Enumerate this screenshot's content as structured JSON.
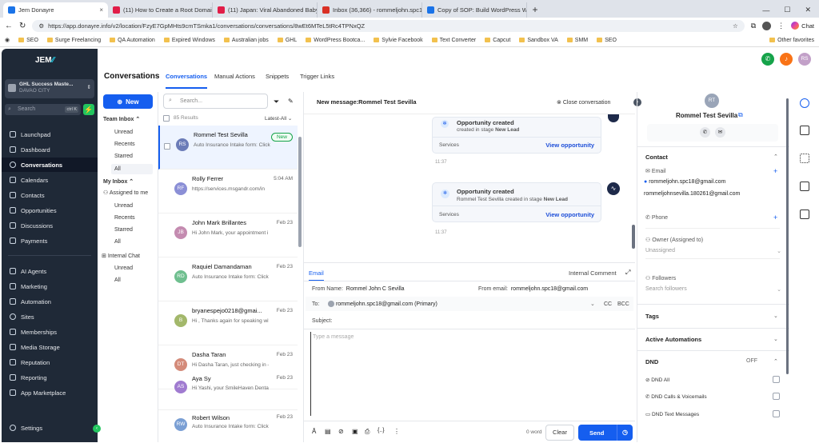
{
  "browser": {
    "tabs": [
      {
        "label": "Jem Donayre",
        "active": true,
        "color": "#1a73e8"
      },
      {
        "label": "(11) How to Create a Root Domain",
        "color": "#e11d48"
      },
      {
        "label": "(11) Japan: Viral Abandoned Baby",
        "color": "#e11d48"
      },
      {
        "label": "Inbox (36,366) - rommeljohn.spc18",
        "color": "#d93025"
      },
      {
        "label": "Copy of SOP: Build WordPress We",
        "color": "#1a73e8"
      }
    ],
    "url": "https://app.donayre.info/v2/location/FzyE7GpMHts9cmTSmka1/conversations/conversations/8wEt6MTeL5tRc4TPNxQZ",
    "chat_label": "Chat",
    "bookmarks": [
      "SEO",
      "Surge Freelancing",
      "QA Automation",
      "Expired Windows",
      "Australian jobs",
      "GHL",
      "WordPress Bootca...",
      "Sylvie Facebook",
      "Text Converter",
      "Capcut",
      "Sandbox VA",
      "SMM",
      "SEO"
    ],
    "other_favorites": "Other favorites"
  },
  "sidebar": {
    "logo": "JEM",
    "location_name": "GHL Success Maste...",
    "location_city": "DAVAO CITY",
    "search_placeholder": "Search",
    "search_shortcut": "ctrl K",
    "items": [
      {
        "label": "Launchpad"
      },
      {
        "label": "Dashboard"
      },
      {
        "label": "Conversations",
        "active": true
      },
      {
        "label": "Calendars"
      },
      {
        "label": "Contacts"
      },
      {
        "label": "Opportunities"
      },
      {
        "label": "Discussions"
      },
      {
        "label": "Payments"
      }
    ],
    "items2": [
      {
        "label": "AI Agents"
      },
      {
        "label": "Marketing"
      },
      {
        "label": "Automation"
      },
      {
        "label": "Sites"
      },
      {
        "label": "Memberships"
      },
      {
        "label": "Media Storage"
      },
      {
        "label": "Reputation"
      },
      {
        "label": "Reporting"
      },
      {
        "label": "App Marketplace"
      }
    ],
    "settings": "Settings"
  },
  "header": {
    "title": "Conversations",
    "tabs": [
      {
        "label": "Conversations",
        "active": true
      },
      {
        "label": "Manual Actions"
      },
      {
        "label": "Snippets"
      },
      {
        "label": "Trigger Links"
      }
    ],
    "user_initials": "RS"
  },
  "filters": {
    "new_label": "New",
    "team_inbox": "Team Inbox",
    "team_items": [
      "Unread",
      "Recents",
      "Starred",
      "All"
    ],
    "my_inbox": "My Inbox",
    "assigned": "Assigned to me",
    "my_items": [
      "Unread",
      "Recents",
      "Starred",
      "All"
    ],
    "internal_chat": "Internal Chat",
    "internal_items": [
      "Unread",
      "All"
    ]
  },
  "list": {
    "search_placeholder": "Search...",
    "count": "85 Results",
    "sort": "Latest-All",
    "conversations": [
      {
        "initials": "RS",
        "name": "Rommel Test Sevilla",
        "preview": "Auto Insurance Intake form: Click",
        "date": "",
        "badge": "New",
        "color": "#6b7cb8"
      },
      {
        "initials": "RF",
        "name": "Rolly Ferrer",
        "preview": "https://services.msgandr.com/in",
        "date": "5:04 AM",
        "color": "#8b8fd6"
      },
      {
        "initials": "JB",
        "name": "John Mark Brillantes",
        "preview": "Hi John Mark, your appointment i",
        "date": "Feb 23",
        "color": "#c48bb0"
      },
      {
        "initials": "RD",
        "name": "Raquiel Damandaman",
        "preview": "Auto Insurance Intake form: Click",
        "date": "Feb 23",
        "color": "#6fbf8f"
      },
      {
        "initials": "B",
        "name": "bryanespejo0218@gmai...",
        "preview": "Hi , Thanks again for speaking wit",
        "date": "Feb 23",
        "color": "#a3b86b"
      },
      {
        "initials": "DT",
        "name": "Dasha Taran",
        "preview": "Hi Dasha Taran, just checking in –",
        "date": "Feb 23",
        "color": "#d48b7a"
      },
      {
        "initials": "AS",
        "name": "Aya Sy",
        "preview": "Hi Yashi, your SmileHaven Dental",
        "date": "Feb 23",
        "color": "#a07bd0"
      },
      {
        "initials": "RW",
        "name": "Robert Wilson",
        "preview": "Auto Insurance Intake form: Click",
        "date": "Feb 23",
        "color": "#7a9fd4"
      }
    ]
  },
  "chat": {
    "title": "New message:Rommel Test Sevilla",
    "close_label": "Close conversation",
    "cards": [
      {
        "title": "Opportunity created",
        "desc_prefix": "created in stage ",
        "stage": "New Lead",
        "service": "Services",
        "link": "View opportunity",
        "time": "11:37"
      },
      {
        "title": "Opportunity created",
        "desc_prefix": "Rommel Test Sevilla created in stage ",
        "stage": "New Lead",
        "service": "Services",
        "link": "View opportunity",
        "time": "11:37"
      }
    ]
  },
  "composer": {
    "tab_email": "Email",
    "tab_internal": "Internal Comment",
    "from_name_label": "From Name:",
    "from_name": "Rommel John C Sevilla",
    "from_email_label": "From email:",
    "from_email": "rommeljohn.spc18@gmail.com",
    "to_label": "To:",
    "to_value": "rommeljohn.spc18@gmail.com (Primary)",
    "cc": "CC",
    "bcc": "BCC",
    "subject_label": "Subject:",
    "placeholder": "Type a message",
    "word_count": "0 word",
    "clear": "Clear",
    "send": "Send"
  },
  "contact": {
    "initials": "RT",
    "name": "Rommel Test Sevilla",
    "contact_heading": "Contact",
    "email_label": "Email",
    "emails": [
      "rommeljohn.spc18@gmail.com",
      "rommeljohnsevilla.180261@gmail.com"
    ],
    "phone_label": "Phone",
    "owner_label": "Owner (Assigned to)",
    "owner_value": "Unassigned",
    "followers_label": "Followers",
    "followers_placeholder": "Search followers",
    "tags": "Tags",
    "automations": "Active Automations",
    "dnd": "DND",
    "dnd_state": "OFF",
    "dnd_items": [
      "DND All",
      "DND Calls & Voicemails",
      "DND Text Messages"
    ]
  }
}
